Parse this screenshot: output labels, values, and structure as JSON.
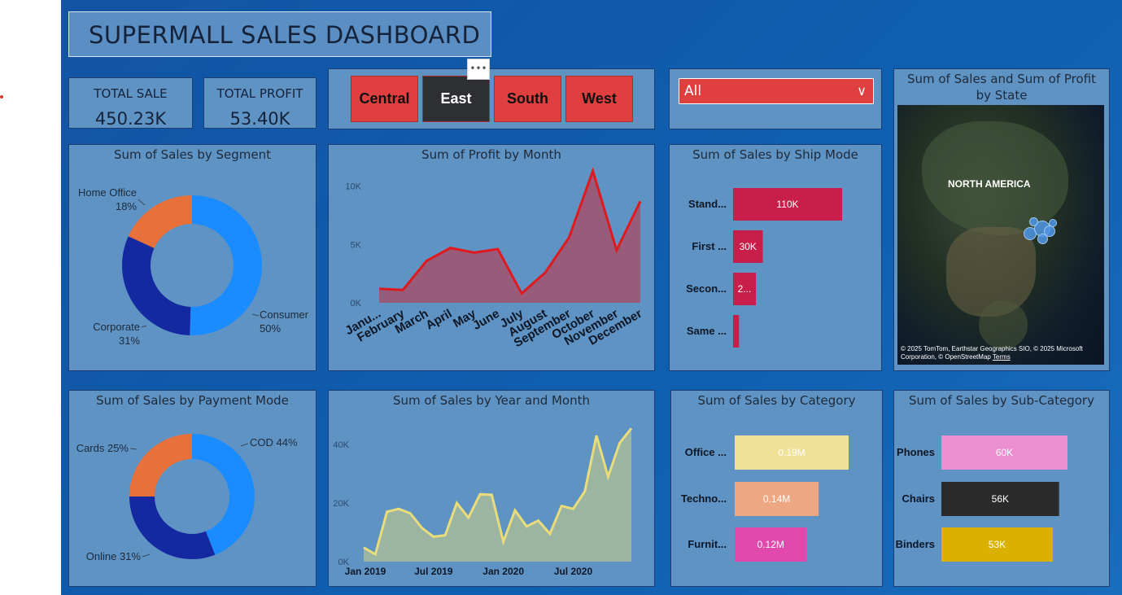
{
  "title": "SUPERMALL SALES DASHBOARD",
  "kpis": [
    {
      "label": "TOTAL SALE",
      "value": "450.23K"
    },
    {
      "label": "TOTAL PROFIT",
      "value": "53.40K"
    }
  ],
  "regions": [
    "Central",
    "East",
    "South",
    "West"
  ],
  "selected_region": "East",
  "more_options": "•••",
  "dropdown": {
    "value": "All",
    "chevron": "∨"
  },
  "map": {
    "title": "Sum of Sales and Sum of Profit by State",
    "label": "NORTH AMERICA",
    "attribution": "© 2025 TomTom, Earthstar Geographics SIO, © 2025 Microsoft Corporation, © OpenStreetMap",
    "terms": "Terms"
  },
  "colors": {
    "accent": "#e03f40",
    "selected": "#2e2f33",
    "panel": "#5e93c4",
    "bar": "#c81f4a"
  },
  "chart_data": [
    {
      "id": "segment",
      "type": "pie",
      "title": "Sum of Sales by Segment",
      "labels": [
        "Consumer",
        "Corporate",
        "Home Office"
      ],
      "values": [
        50,
        31,
        18
      ],
      "display": [
        "50%",
        "31%",
        "18%"
      ],
      "colors": [
        "#1a8cff",
        "#1428a0",
        "#e8703a"
      ]
    },
    {
      "id": "profit_month",
      "type": "area",
      "title": "Sum of Profit by Month",
      "categories": [
        "Janu...",
        "February",
        "March",
        "April",
        "May",
        "June",
        "July",
        "August",
        "September",
        "October",
        "November",
        "December"
      ],
      "values": [
        1200,
        1100,
        3600,
        4700,
        4300,
        4600,
        800,
        2600,
        5600,
        11300,
        4500,
        8700
      ],
      "yticks": [
        "0K",
        "5K",
        "10K"
      ],
      "ylim": [
        0,
        12000
      ],
      "color": "#e0191f"
    },
    {
      "id": "ship_mode",
      "type": "bar",
      "title": "Sum of Sales by Ship Mode",
      "categories": [
        "Stand...",
        "First ...",
        "Secon...",
        "Same ..."
      ],
      "values": [
        110,
        30,
        23,
        6
      ],
      "labels": [
        "110K",
        "30K",
        "2...",
        ""
      ],
      "color": "#c81f4a"
    },
    {
      "id": "payment_mode",
      "type": "pie",
      "title": "Sum of Sales by Payment Mode",
      "labels": [
        "COD",
        "Online",
        "Cards"
      ],
      "values": [
        44,
        31,
        25
      ],
      "display": [
        "COD 44%",
        "Online 31%",
        "Cards 25%"
      ],
      "colors": [
        "#1a8cff",
        "#1428a0",
        "#e8703a"
      ]
    },
    {
      "id": "sales_year_month",
      "type": "area",
      "title": "Sum of Sales by Year and Month",
      "values": [
        4800,
        2500,
        17000,
        18000,
        16500,
        11500,
        8500,
        9000,
        20000,
        15000,
        23000,
        22800,
        6800,
        17500,
        12000,
        14000,
        9500,
        19000,
        18000,
        24000,
        43000,
        29000,
        40500,
        45500
      ],
      "xticks": [
        "Jan 2019",
        "Jul 2019",
        "Jan 2020",
        "Jul 2020"
      ],
      "yticks": [
        "0K",
        "20K",
        "40K"
      ],
      "ylim": [
        0,
        50000
      ],
      "color": "#e8dd7a"
    },
    {
      "id": "category",
      "type": "bar",
      "title": "Sum of Sales by Category",
      "categories": [
        "Office ...",
        "Techno...",
        "Furnit..."
      ],
      "values": [
        0.19,
        0.14,
        0.12
      ],
      "labels": [
        "0.19M",
        "0.14M",
        "0.12M"
      ],
      "colors": [
        "#efe197",
        "#eda783",
        "#e249ad"
      ]
    },
    {
      "id": "sub_category",
      "type": "bar",
      "title": "Sum of Sales by Sub-Category",
      "categories": [
        "Phones",
        "Chairs",
        "Binders"
      ],
      "values": [
        60,
        56,
        53
      ],
      "labels": [
        "60K",
        "56K",
        "53K"
      ],
      "colors": [
        "#ec8fd0",
        "#2b2b2b",
        "#dab100"
      ]
    }
  ]
}
